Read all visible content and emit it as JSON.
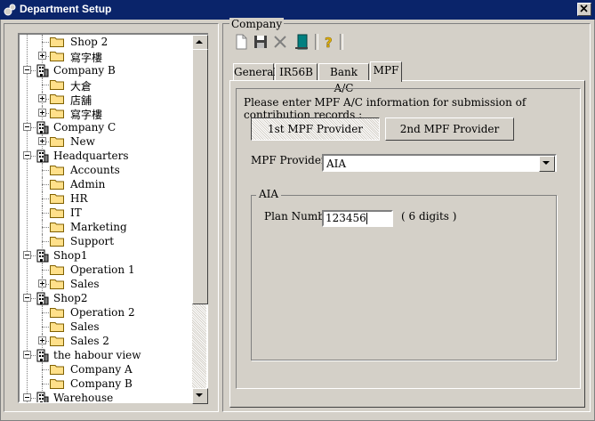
{
  "window": {
    "title": "Department Setup"
  },
  "tree": {
    "items": [
      {
        "label": "Shop 2",
        "level": 2,
        "type": "folder",
        "expander": "none"
      },
      {
        "label": "寫字樓",
        "level": 2,
        "type": "folder",
        "expander": "plus"
      },
      {
        "label": "Company B",
        "level": 1,
        "type": "building",
        "expander": "minus"
      },
      {
        "label": "大倉",
        "level": 2,
        "type": "folder",
        "expander": "none"
      },
      {
        "label": "店舖",
        "level": 2,
        "type": "folder",
        "expander": "plus"
      },
      {
        "label": "寫字樓",
        "level": 2,
        "type": "folder",
        "expander": "plus"
      },
      {
        "label": "Company C",
        "level": 1,
        "type": "building",
        "expander": "minus"
      },
      {
        "label": "New",
        "level": 2,
        "type": "folder",
        "expander": "plus"
      },
      {
        "label": "Headquarters",
        "level": 1,
        "type": "building",
        "expander": "minus"
      },
      {
        "label": "Accounts",
        "level": 2,
        "type": "folder",
        "expander": "none"
      },
      {
        "label": "Admin",
        "level": 2,
        "type": "folder",
        "expander": "none"
      },
      {
        "label": "HR",
        "level": 2,
        "type": "folder",
        "expander": "none"
      },
      {
        "label": "IT",
        "level": 2,
        "type": "folder",
        "expander": "none"
      },
      {
        "label": "Marketing",
        "level": 2,
        "type": "folder",
        "expander": "none"
      },
      {
        "label": "Support",
        "level": 2,
        "type": "folder",
        "expander": "none"
      },
      {
        "label": "Shop1",
        "level": 1,
        "type": "building",
        "expander": "minus"
      },
      {
        "label": "Operation 1",
        "level": 2,
        "type": "folder",
        "expander": "none"
      },
      {
        "label": "Sales",
        "level": 2,
        "type": "folder",
        "expander": "plus"
      },
      {
        "label": "Shop2",
        "level": 1,
        "type": "building",
        "expander": "minus"
      },
      {
        "label": "Operation 2",
        "level": 2,
        "type": "folder",
        "expander": "none"
      },
      {
        "label": "Sales",
        "level": 2,
        "type": "folder",
        "expander": "none"
      },
      {
        "label": "Sales 2",
        "level": 2,
        "type": "folder",
        "expander": "plus"
      },
      {
        "label": "the habour view",
        "level": 1,
        "type": "building",
        "expander": "minus"
      },
      {
        "label": "Company A",
        "level": 2,
        "type": "folder",
        "expander": "none"
      },
      {
        "label": "Company B",
        "level": 2,
        "type": "folder",
        "expander": "none"
      },
      {
        "label": "Warehouse",
        "level": 1,
        "type": "building",
        "expander": "minus"
      }
    ]
  },
  "company": {
    "group_label": "Company",
    "toolbar": [
      "new-icon",
      "save-icon",
      "delete-icon",
      "exit-icon",
      "help-icon"
    ],
    "tabs": [
      {
        "label": "General",
        "active": false
      },
      {
        "label": "IR56B",
        "active": false
      },
      {
        "label": "Bank A/C",
        "active": false
      },
      {
        "label": "MPF",
        "active": true
      }
    ],
    "mpf": {
      "instruction": "Please enter MPF A/C information for submission of contribution records :",
      "provider_buttons": [
        "1st MPF Provider",
        "2nd MPF Provider"
      ],
      "provider_label": "MPF Provider",
      "provider_value": "AIA",
      "group_title": "AIA",
      "plan_label": "Plan Number",
      "plan_value": "123456",
      "plan_hint": "( 6 digits )"
    }
  },
  "colors": {
    "titlebar": "#0a246a",
    "face": "#d4d0c8",
    "folder": "#ffe08a"
  }
}
